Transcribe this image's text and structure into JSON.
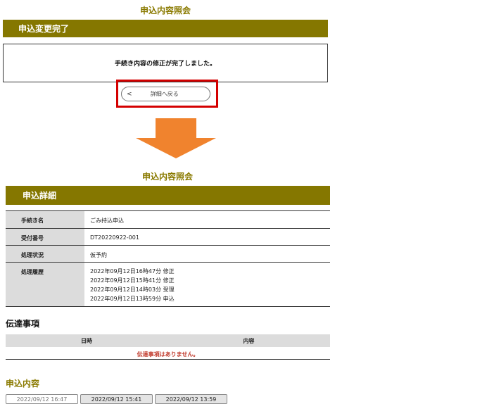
{
  "top": {
    "page_title": "申込内容照会",
    "band_title": "申込変更完了",
    "message": "手続き内容の修正が完了しました。",
    "back_button": {
      "chevron": "<",
      "label": "詳細へ戻る"
    }
  },
  "arrow": {
    "color": "#f0832e",
    "icon": "down-arrow-icon"
  },
  "bottom": {
    "page_title": "申込内容照会",
    "band_title": "申込詳細",
    "rows": [
      {
        "label": "手続き名",
        "value": "ごみ持込申込"
      },
      {
        "label": "受付番号",
        "value": "DT20220922-001"
      },
      {
        "label": "処理状況",
        "value": "仮予約"
      }
    ],
    "history": {
      "label": "処理履歴",
      "entries": [
        "2022年09月12日16時47分 修正",
        "2022年09月12日15時41分 修正",
        "2022年09月12日14時03分 受理",
        "2022年09月12日13時59分 申込"
      ]
    }
  },
  "dengon": {
    "title": "伝達事項",
    "col_date": "日時",
    "col_content": "内容",
    "empty_message": "伝達事項はありません。"
  },
  "application": {
    "title": "申込内容",
    "tabs": [
      {
        "label": "2022/09/12 16:47",
        "active": true
      },
      {
        "label": "2022/09/12 15:41",
        "active": false
      },
      {
        "label": "2022/09/12 13:59",
        "active": false
      }
    ]
  },
  "colors": {
    "olive": "#857700",
    "olive_text": "#8a7a00",
    "highlight_red": "#d40000",
    "arrow_orange": "#f0832e",
    "notice_red": "#c0392b"
  }
}
